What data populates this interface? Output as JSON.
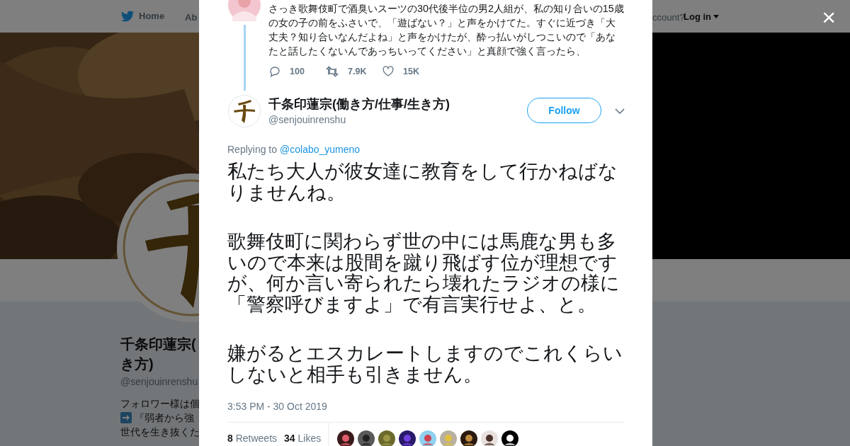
{
  "top_nav": {
    "home": "Home",
    "about": "Ab",
    "account_prompt": "ccount?",
    "login": "Log in"
  },
  "profile": {
    "name_lines": [
      "千条印蓮宗(",
      "き方)"
    ],
    "handle": "@senjouinrenshu",
    "bio_lines": [
      [
        {
          "kind": "text",
          "text": "フォロワー様は個"
        }
      ],
      [
        {
          "kind": "arrow"
        },
        {
          "kind": "text",
          "text": "『弱者から強"
        }
      ],
      [
        {
          "kind": "text",
          "text": "世代を生き抜くた"
        }
      ]
    ]
  },
  "previous_tweet": {
    "text": "さっき歌舞伎町で酒臭いスーツの30代後半位の男2人組が、私の知り合いの15歳の女の子の前をふさいで、「遊ばない？」と声をかけてた。すぐに近づき「大丈夫？知り合いなんだよね」と声をかけたが、酔っ払いがしつこいので「あなたと話したくないんであっちいってください」と真顔で強く言ったら、",
    "replies": "100",
    "retweets": "7.9K",
    "likes": "15K"
  },
  "tweet": {
    "name": "千条印蓮宗(働き方/仕事/生き方)",
    "handle": "@senjouinrenshu",
    "follow": "Follow",
    "replying_prefix": "Replying to",
    "reply_to": "@colabo_yumeno",
    "paragraphs": [
      "私たち大人が彼女達に教育をして行かねばなりませんね。",
      "歌舞伎町に関わらず世の中には馬鹿な男も多いので本来は股間を蹴り飛ばす位が理想ですが、何か言い寄られたら壊れたラジオの様に「警察呼びますよ」で有言実行せよ、と。",
      "嫌がるとエスカレートしますのでこれくらいしないと相手も引きません。"
    ],
    "timestamp": "3:53 PM - 30 Oct 2019",
    "retweets_count": "8",
    "retweets_label": "Retweets",
    "likes_count": "34",
    "likes_label": "Likes"
  },
  "close": "×"
}
